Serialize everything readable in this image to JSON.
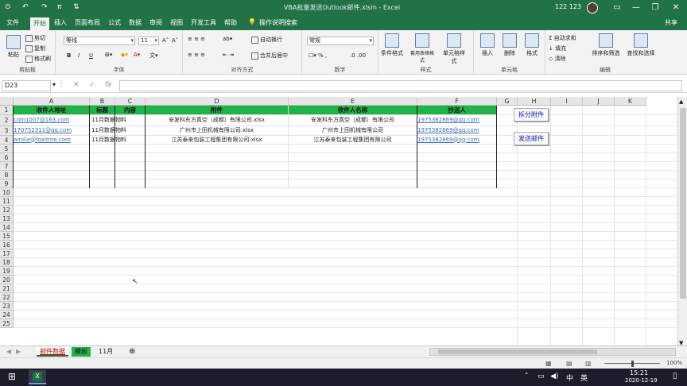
{
  "titlebar": {
    "undo": "↶",
    "redo": "↷",
    "save": "⊙",
    "pi": "π",
    "sort": "⇅",
    "title": "VBA批量发送Outlook邮件.xlsm - Excel",
    "user": "122 123",
    "min": "—",
    "restore": "❐",
    "close": "✕"
  },
  "tabs": {
    "items": [
      "文件",
      "开始",
      "插入",
      "页面布局",
      "公式",
      "数据",
      "审阅",
      "视图",
      "开发工具",
      "帮助",
      "操作说明搜索"
    ],
    "share": "共享"
  },
  "ribbon": {
    "clipboard": {
      "cut": "剪切",
      "copy": "复制",
      "painter": "格式刷",
      "paste": "粘贴",
      "label": "剪贴板"
    },
    "font": {
      "name": "等线",
      "size": "11",
      "grow": "A˄",
      "shrink": "A˅",
      "bold": "B",
      "italic": "I",
      "underline": "U",
      "label": "字体"
    },
    "align": {
      "wrap": "自动换行",
      "merge": "合并后居中",
      "label": "对齐方式"
    },
    "number": {
      "format": "常规",
      "label": "数字"
    },
    "styles": {
      "cond": "条件格式",
      "table": "套用表格格式",
      "cell": "单元格样式",
      "label": "样式"
    },
    "cells": {
      "insert": "插入",
      "delete": "删除",
      "format": "格式",
      "label": "单元格"
    },
    "editing": {
      "autosum": "自动求和",
      "fill": "填充",
      "clear": "清除",
      "sort": "排序和筛选",
      "find": "查找和选择",
      "label": "编辑"
    }
  },
  "formula_bar": {
    "name_box": "D23",
    "cancel": "✕",
    "enter": "✓",
    "fx": "fx",
    "value": ""
  },
  "sheet": {
    "columns": [
      "A",
      "B",
      "C",
      "D",
      "E",
      "F",
      "G",
      "H",
      "I",
      "J",
      "K"
    ],
    "rows": [
      "1",
      "2",
      "3",
      "4",
      "5",
      "6",
      "7",
      "8",
      "9",
      "10",
      "11",
      "12",
      "13",
      "14",
      "15",
      "16",
      "17",
      "18",
      "19",
      "20",
      "21",
      "22",
      "23",
      "24",
      "25"
    ],
    "headers": [
      "收件人地址",
      "标题",
      "内容",
      "附件",
      "收件人名称",
      "抄送人"
    ],
    "data": [
      [
        "com1007@163.com",
        "11月数据",
        "物料",
        "安发科东方真空（成都）有限公司.xlsx",
        "安发科东方真空（成都）有限公司",
        "1975382869@qq.com"
      ],
      [
        "170752311@qq.com",
        "11月数据",
        "物料",
        "广州市上田机械有限公司.xlsx",
        "广州市上田机械有限公司",
        "1975382869@qq.com"
      ],
      [
        "amilie@foxitme.com",
        "11月数据",
        "物料",
        "江苏泰来包装工程集团有限公司.xlsx",
        "江苏泰来包装工程集团有限公司",
        "1975382869@qq.com"
      ]
    ],
    "buttons": {
      "split": "拆分附件",
      "send": "发送邮件"
    }
  },
  "sheet_tabs": {
    "prev": "◀",
    "next": "▶",
    "tabs": [
      "邮件数据",
      "模板",
      "11月"
    ],
    "add": "⊕"
  },
  "statusbar": {
    "zoom": "100%"
  },
  "taskbar": {
    "start": "⊞",
    "search": "○",
    "taskview": "⧉",
    "excel": "X",
    "time": "15:21",
    "date": "2020-12-19"
  },
  "colors": {
    "excel_green": "#217346",
    "header_green": "#1fb34a",
    "link": "#3a6fb5"
  }
}
